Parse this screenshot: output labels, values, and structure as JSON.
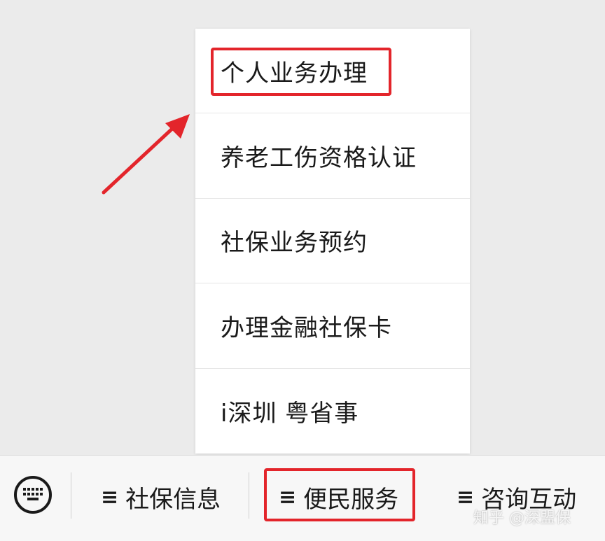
{
  "popup_menu": {
    "items": [
      {
        "label": "个人业务办理"
      },
      {
        "label": "养老工伤资格认证"
      },
      {
        "label": "社保业务预约"
      },
      {
        "label": "办理金融社保卡"
      },
      {
        "label": "i深圳 粤省事"
      }
    ]
  },
  "bottom_bar": {
    "keyboard_icon": "keyboard-icon",
    "menu_icon_glyph": "≡",
    "tabs": [
      {
        "label": "社保信息"
      },
      {
        "label": "便民服务"
      },
      {
        "label": "咨询互动"
      }
    ]
  },
  "watermark": "知乎 @深盟保",
  "colors": {
    "highlight": "#e3252b",
    "background": "#ebebeb",
    "menu_background": "#ffffff"
  }
}
